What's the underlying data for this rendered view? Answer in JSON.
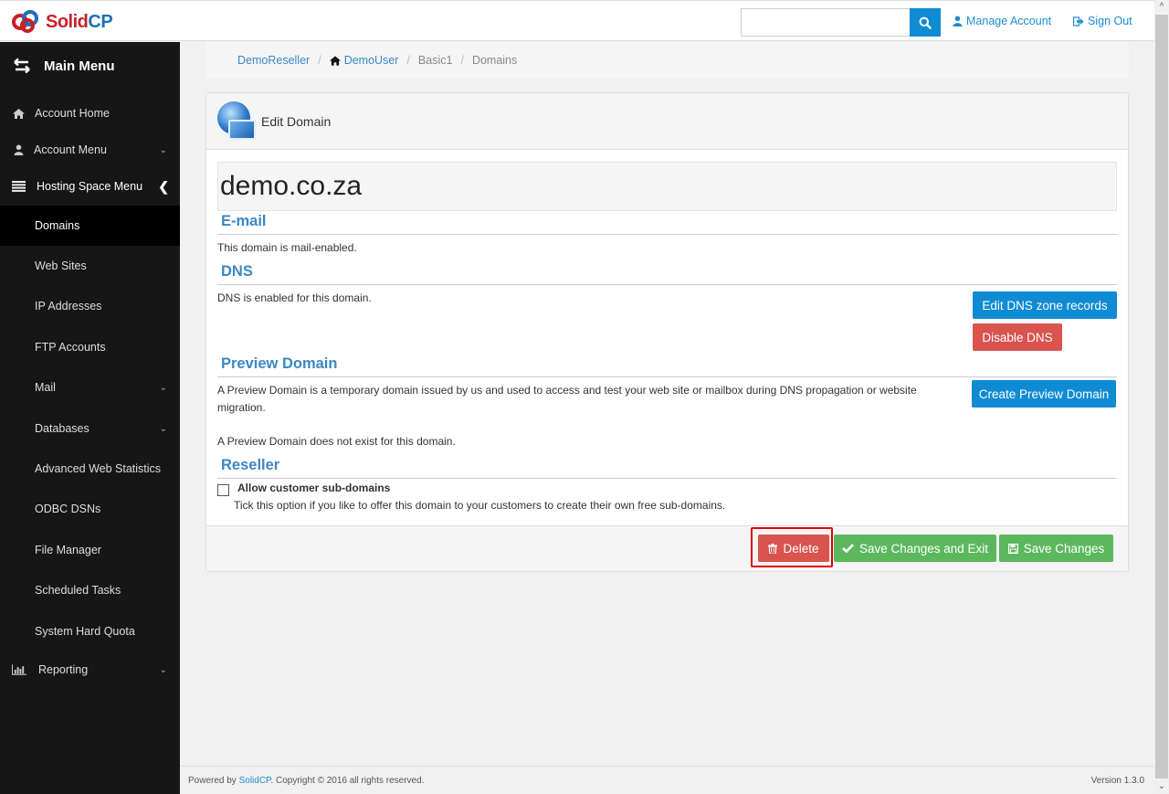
{
  "app": {
    "brand_part1": "Solid",
    "brand_part2": "CP"
  },
  "header": {
    "search_placeholder": "",
    "search_value": "",
    "search_icon": "search-icon",
    "manage_account": "Manage Account",
    "sign_out": "Sign Out"
  },
  "sidebar": {
    "title": "Main Menu",
    "items": [
      {
        "label": "Account Home",
        "icon": "home-icon"
      },
      {
        "label": "Account Menu",
        "icon": "user-icon",
        "chevron": "down"
      },
      {
        "label": "Hosting Space Menu",
        "icon": "server-icon",
        "chevron": "left"
      },
      {
        "label": "Domains",
        "active": true
      },
      {
        "label": "Web Sites"
      },
      {
        "label": "IP Addresses"
      },
      {
        "label": "FTP Accounts"
      },
      {
        "label": "Mail",
        "chevron": "down"
      },
      {
        "label": "Databases",
        "chevron": "down"
      },
      {
        "label": "Advanced Web Statistics"
      },
      {
        "label": "ODBC DSNs"
      },
      {
        "label": "File Manager"
      },
      {
        "label": "Scheduled Tasks"
      },
      {
        "label": "System Hard Quota"
      },
      {
        "label": "Reporting",
        "icon": "bar-chart-icon",
        "chevron": "down"
      }
    ]
  },
  "breadcrumb": {
    "items": [
      "DemoReseller",
      "DemoUser",
      "Basic1",
      "Domains"
    ],
    "separator": "/"
  },
  "panel": {
    "title": "Edit Domain",
    "domain_name": "demo.co.za",
    "email": {
      "title": "E-mail",
      "text": "This domain is mail-enabled."
    },
    "dns": {
      "title": "DNS",
      "text": "DNS is enabled for this domain.",
      "edit_button": "Edit DNS zone records",
      "disable_button": "Disable DNS"
    },
    "preview": {
      "title": "Preview Domain",
      "text_line1": "A Preview Domain is a temporary domain issued by us and used to access and test your web site or mailbox during DNS propagation or website",
      "text_line2": "migration.",
      "status": "A Preview Domain does not exist for this domain.",
      "create_button": "Create Preview Domain"
    },
    "reseller": {
      "title": "Reseller",
      "checkbox_label": "Allow customer sub-domains",
      "checkbox_checked": false,
      "help": "Tick this option if you like to offer this domain to your customers to create their own free sub-domains."
    },
    "actions": {
      "delete": "Delete",
      "save_exit": "Save Changes and Exit",
      "save": "Save Changes"
    }
  },
  "footer": {
    "powered_prefix": "Powered by ",
    "powered_link": "SolidCP",
    "powered_suffix": ". Copyright © 2016 all rights reserved.",
    "version": "Version 1.3.0"
  },
  "colors": {
    "primary": "#0f8bd3",
    "danger": "#d9534f",
    "success": "#5cb85c",
    "link": "#3a87c4",
    "sidebar_bg": "#161616"
  }
}
